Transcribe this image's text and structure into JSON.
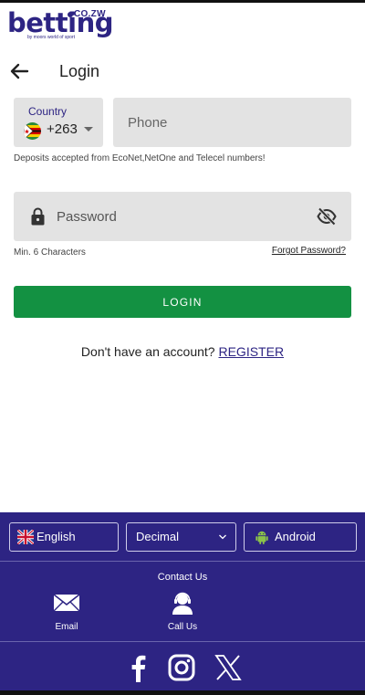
{
  "logo": {
    "main": "betting",
    "domain": "co.zw",
    "tagline": "by moors world of sport"
  },
  "header": {
    "title": "Login"
  },
  "country": {
    "label": "Country",
    "dial_code": "+263",
    "flag": "zimbabwe-flag"
  },
  "phone": {
    "placeholder": "Phone",
    "value": ""
  },
  "deposit_note": "Deposits accepted from EcoNet,NetOne and Telecel numbers!",
  "password": {
    "placeholder": "Password",
    "value": "",
    "hint": "Min. 6 Characters",
    "forgot_label": "Forgot Password?"
  },
  "login_label": "LOGIN",
  "register": {
    "prompt": "Don't have an account?",
    "link": "REGISTER"
  },
  "footer": {
    "language": "English",
    "odds_format": "Decimal",
    "app": "Android",
    "contact_title": "Contact Us",
    "email_label": "Email",
    "call_label": "Call Us",
    "socials": [
      "facebook-icon",
      "instagram-icon",
      "x-icon"
    ]
  },
  "colors": {
    "brand": "#2d2483",
    "login_button": "#139142",
    "input_bg": "#e3e3e3"
  }
}
